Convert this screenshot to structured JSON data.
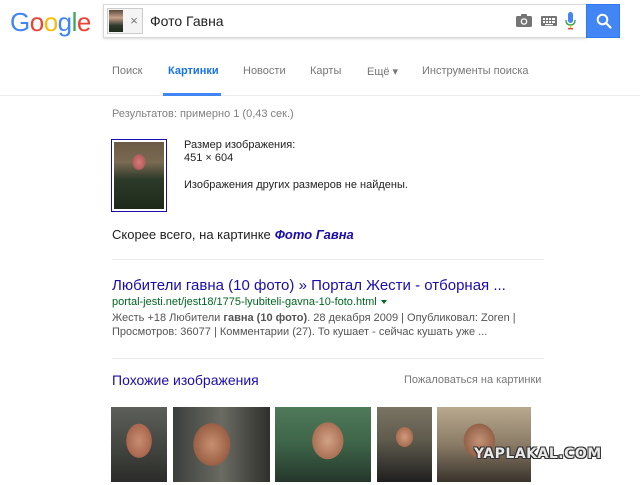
{
  "header": {
    "logo_letters": [
      {
        "ch": "G",
        "color": "#4285f4"
      },
      {
        "ch": "o",
        "color": "#ea4335"
      },
      {
        "ch": "o",
        "color": "#fbbc05"
      },
      {
        "ch": "g",
        "color": "#4285f4"
      },
      {
        "ch": "l",
        "color": "#34a853"
      },
      {
        "ch": "e",
        "color": "#ea4335"
      }
    ],
    "search_query": "Фото Гавна",
    "remove_image_glyph": "×",
    "icons": [
      "camera-icon",
      "keyboard-icon",
      "mic-icon",
      "search-icon"
    ],
    "accent": "#4285f4"
  },
  "tabs": [
    {
      "label": "Поиск",
      "active": false
    },
    {
      "label": "Картинки",
      "active": true
    },
    {
      "label": "Новости",
      "active": false
    },
    {
      "label": "Карты",
      "active": false
    },
    {
      "label": "Ещё ▾",
      "active": false
    },
    {
      "label": "Инструменты поиска",
      "active": false
    }
  ],
  "results": {
    "stats": "Результатов: примерно 1 (0,43 сек.)",
    "image_size_label": "Размер изображения:",
    "image_size_value": "451 × 604",
    "no_other_sizes": "Изображения других размеров не найдены.",
    "best_guess_prefix": "Скорее всего, на картинке",
    "best_guess_link": "Фото Гавна"
  },
  "result": {
    "title": "Любители гавна (10 фото) » Портал Жести - отборная ...",
    "url": "portal-jesti.net/jest18/1775-lyubiteli-gavna-10-foto.html",
    "snippet_line1_pre": "Жесть +18 Любители ",
    "snippet_line1_bold": "гавна (10 фото)",
    "snippet_line1_post": ". 28 декабря 2009 | Опубликовал: Zoren |",
    "snippet_line2": "Просмотров: 36077 | Комментарии (27). То кушает - сейчас кушать уже ..."
  },
  "similar": {
    "heading": "Похожие изображения",
    "report_link": "Пожаловаться на картинки",
    "images": [
      "similar-photo-1",
      "similar-photo-2",
      "similar-photo-3",
      "similar-photo-4",
      "similar-photo-5"
    ]
  },
  "watermark": "YAPLAKAL.COM"
}
